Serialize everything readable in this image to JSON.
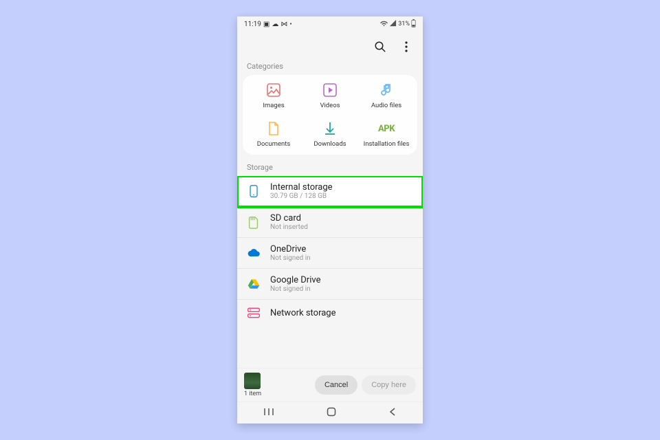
{
  "statusbar": {
    "time": "11:19",
    "battery": "31%"
  },
  "sections": {
    "categories": "Categories",
    "storage": "Storage"
  },
  "categories": [
    {
      "label": "Images"
    },
    {
      "label": "Videos"
    },
    {
      "label": "Audio files"
    },
    {
      "label": "Documents"
    },
    {
      "label": "Downloads"
    },
    {
      "label": "Installation files"
    }
  ],
  "storage": [
    {
      "title": "Internal storage",
      "sub": "30.79 GB / 128 GB"
    },
    {
      "title": "SD card",
      "sub": "Not inserted"
    },
    {
      "title": "OneDrive",
      "sub": "Not signed in"
    },
    {
      "title": "Google Drive",
      "sub": "Not signed in"
    },
    {
      "title": "Network storage",
      "sub": ""
    }
  ],
  "selection": {
    "count": "1 item"
  },
  "buttons": {
    "cancel": "Cancel",
    "copy": "Copy here"
  }
}
